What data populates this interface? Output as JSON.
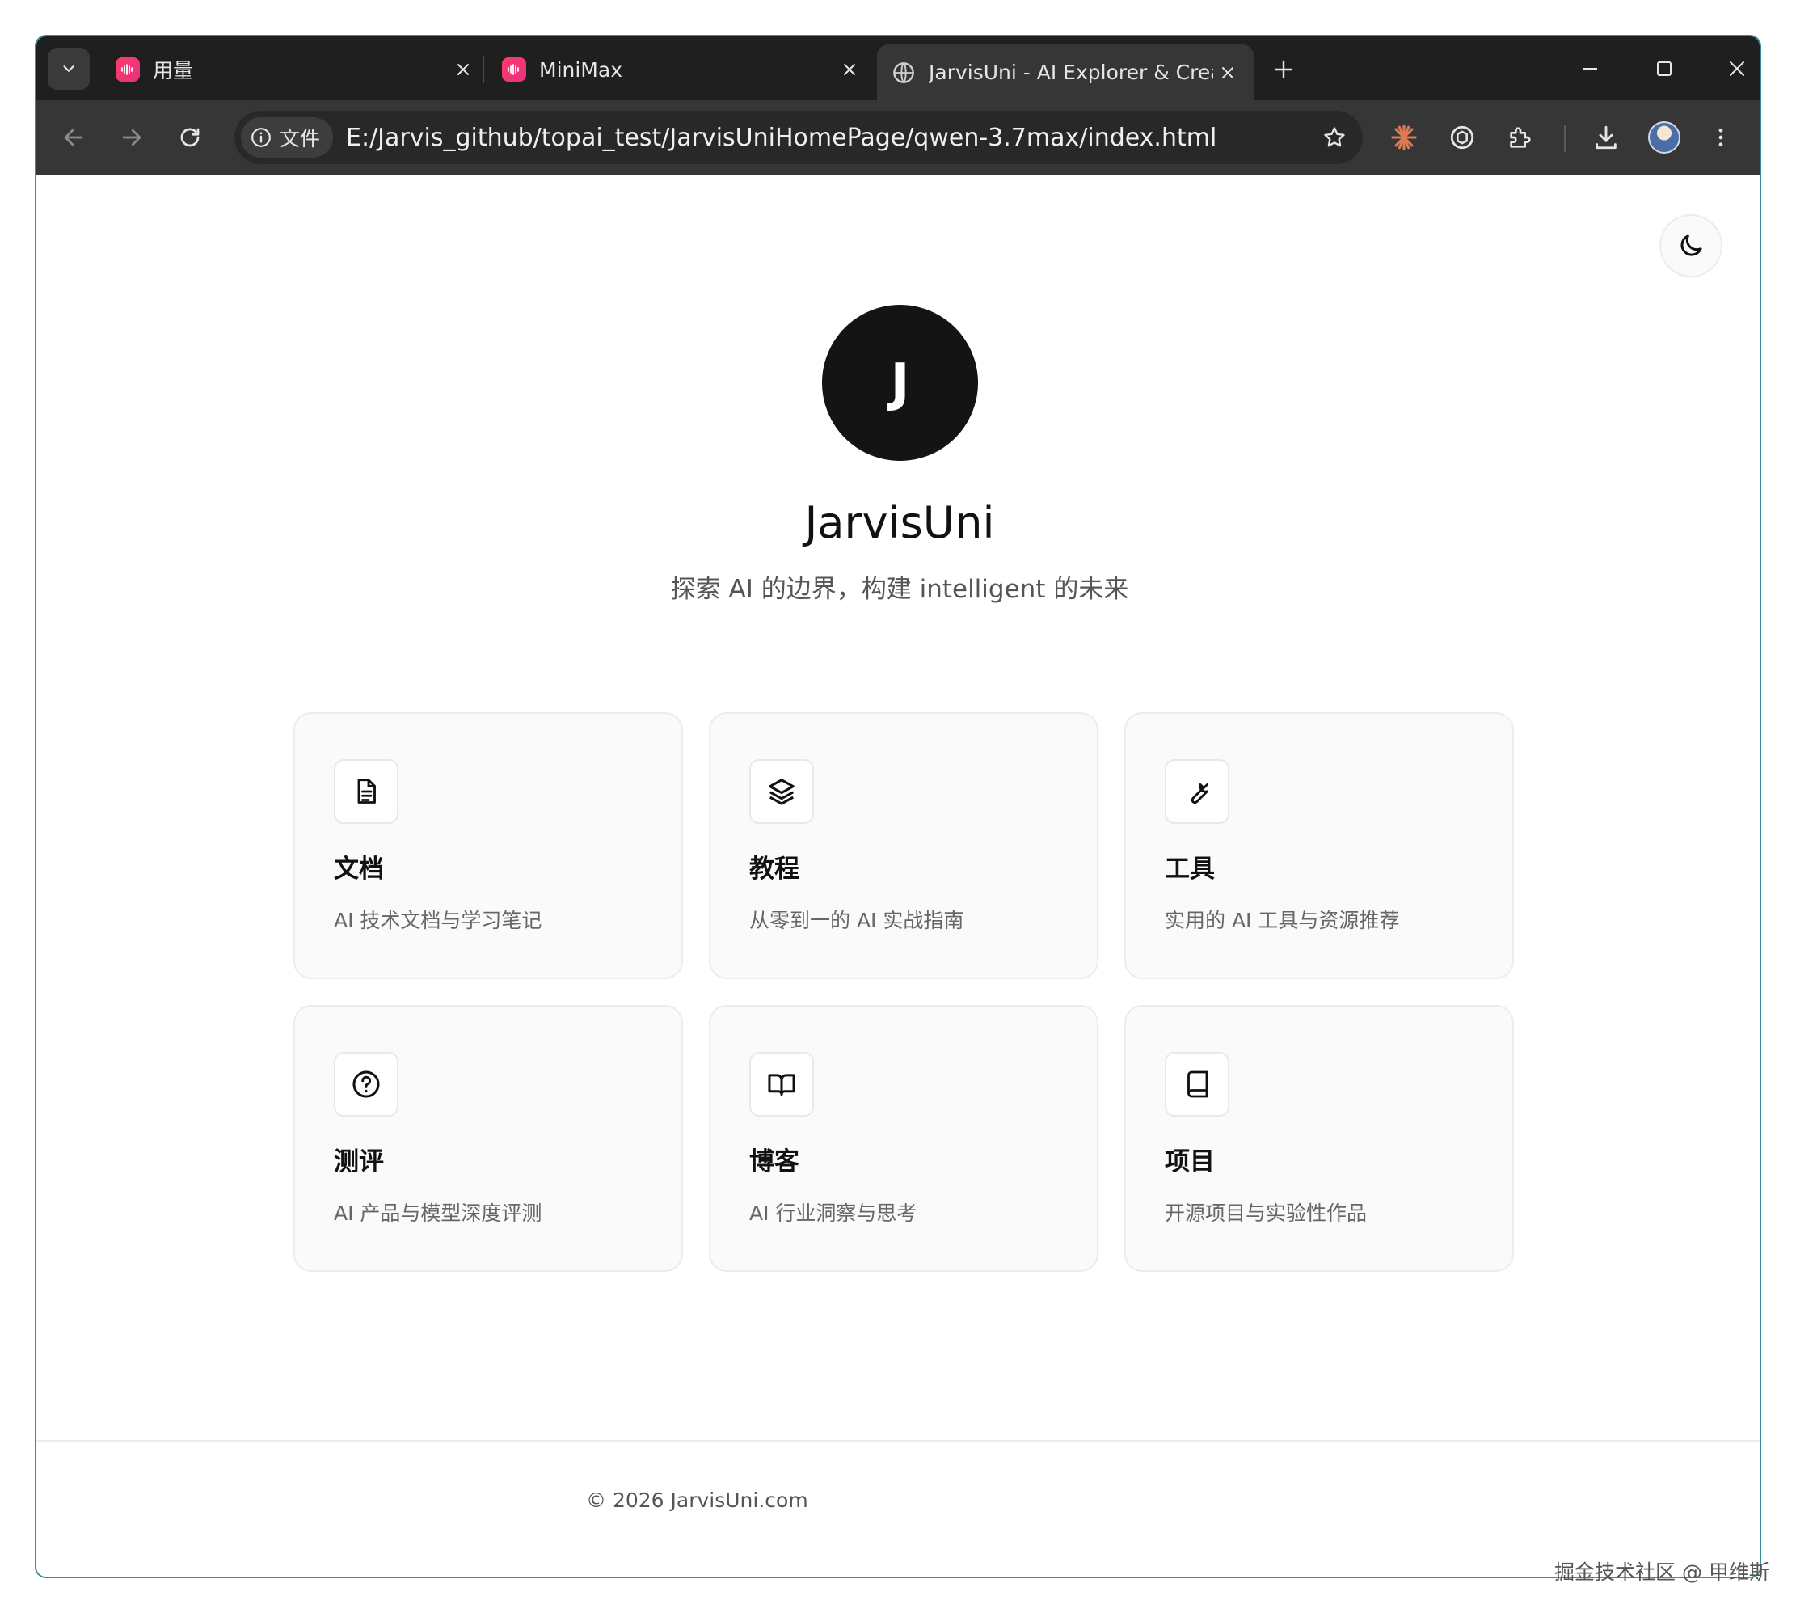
{
  "browser": {
    "tabs": [
      {
        "title": "用量",
        "favicon": "minimax-icon"
      },
      {
        "title": "MiniMax",
        "favicon": "minimax-icon"
      },
      {
        "title": "JarvisUni - AI Explorer & Crea",
        "favicon": "globe-icon",
        "active": true
      }
    ],
    "address": {
      "chip_label": "文件",
      "url": "E:/Jarvis_github/topai_test/JarvisUniHomePage/qwen-3.7max/index.html"
    }
  },
  "page": {
    "logo_letter": "J",
    "title": "JarvisUni",
    "tagline": "探索 AI 的边界，构建 intelligent 的未来",
    "cards": [
      {
        "icon": "document-icon",
        "title": "文档",
        "desc": "AI 技术文档与学习笔记"
      },
      {
        "icon": "layers-icon",
        "title": "教程",
        "desc": "从零到一的 AI 实战指南"
      },
      {
        "icon": "wrench-icon",
        "title": "工具",
        "desc": "实用的 AI 工具与资源推荐"
      },
      {
        "icon": "question-circle-icon",
        "title": "测评",
        "desc": "AI 产品与模型深度评测"
      },
      {
        "icon": "open-book-icon",
        "title": "博客",
        "desc": "AI 行业洞察与思考"
      },
      {
        "icon": "book-icon",
        "title": "项目",
        "desc": "开源项目与实验性作品"
      }
    ],
    "footer": {
      "copyright": "© 2026 JarvisUni.com"
    }
  },
  "watermark": "掘金技术社区 @ 甲维斯",
  "colors": {
    "accent": "#141414",
    "chrome_dark": "#1f1f1f",
    "chrome_toolbar": "#363636",
    "card_bg": "#fafafa"
  }
}
